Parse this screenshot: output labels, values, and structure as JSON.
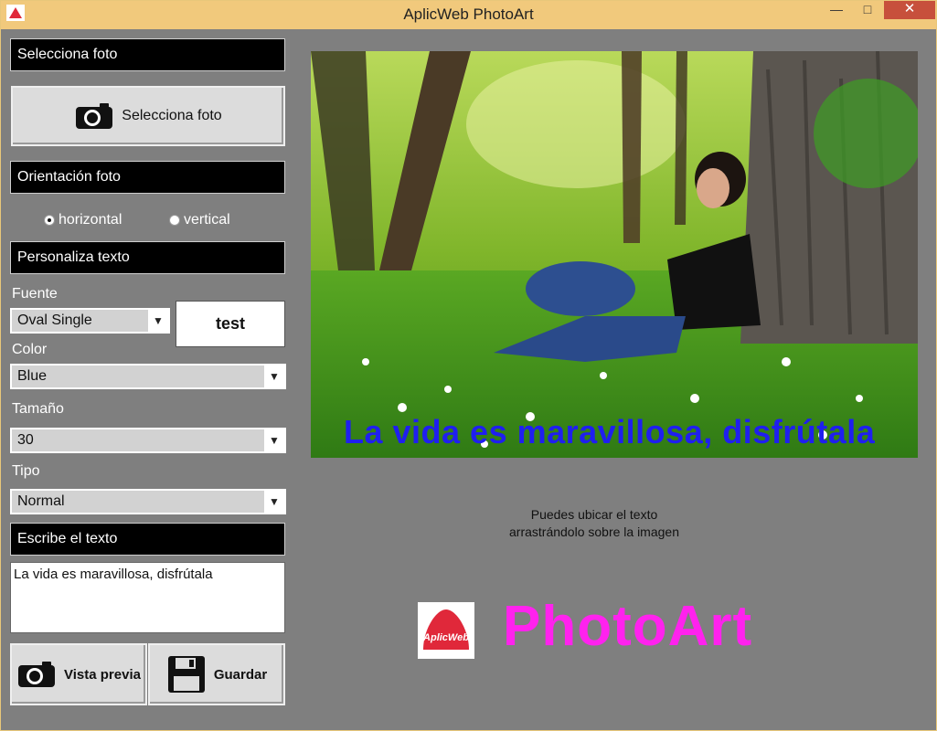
{
  "window": {
    "title": "AplicWeb PhotoArt",
    "min": "—",
    "max": "□",
    "close": "✕"
  },
  "sidebar": {
    "select_header": "Selecciona foto",
    "select_button": "Selecciona foto",
    "orientation_header": "Orientación foto",
    "orientation_options": [
      {
        "label": "horizontal",
        "checked": true
      },
      {
        "label": "vertical",
        "checked": false
      }
    ],
    "text_header": "Personaliza texto",
    "font_label": "Fuente",
    "font_value": "Oval Single",
    "font_preview": "test",
    "color_label": "Color",
    "color_value": "Blue",
    "size_label": "Tamaño",
    "size_value": "30",
    "type_label": "Tipo",
    "type_value": "Normal",
    "write_header": "Escribe el texto",
    "text_value": "La vida es maravillosa, disfrútala",
    "preview_button": "Vista previa",
    "save_button": "Guardar"
  },
  "main": {
    "caption": "La vida es maravillosa, disfrútala",
    "hint_line1": "Puedes ubicar el texto",
    "hint_line2": "arrastrándolo sobre la imagen",
    "logo_badge": "AplicWeb",
    "logo_text": "PhotoArt"
  },
  "colors": {
    "titlebar": "#f1c97c",
    "background": "#7f7f7f",
    "caption": "#1f1ff0",
    "brand": "#ff22ee",
    "logo_red": "#e0283a"
  }
}
